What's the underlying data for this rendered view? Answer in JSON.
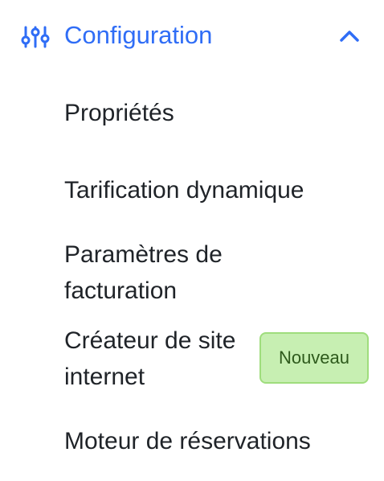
{
  "section": {
    "title": "Configuration",
    "icon": "settings-sliders-icon",
    "toggle_icon": "chevron-up-icon",
    "accent_color": "#2f6df6",
    "expanded": true
  },
  "items": [
    {
      "label": "Propriétés"
    },
    {
      "label": "Tarification dynamique"
    },
    {
      "label": "Paramètres de facturation"
    },
    {
      "label": "Créateur de site internet",
      "badge": "Nouveau"
    },
    {
      "label": "Moteur de réservations"
    }
  ],
  "badge_colors": {
    "background": "#c7efb2",
    "border": "#9fdd7d",
    "text": "#2e5a1c"
  }
}
